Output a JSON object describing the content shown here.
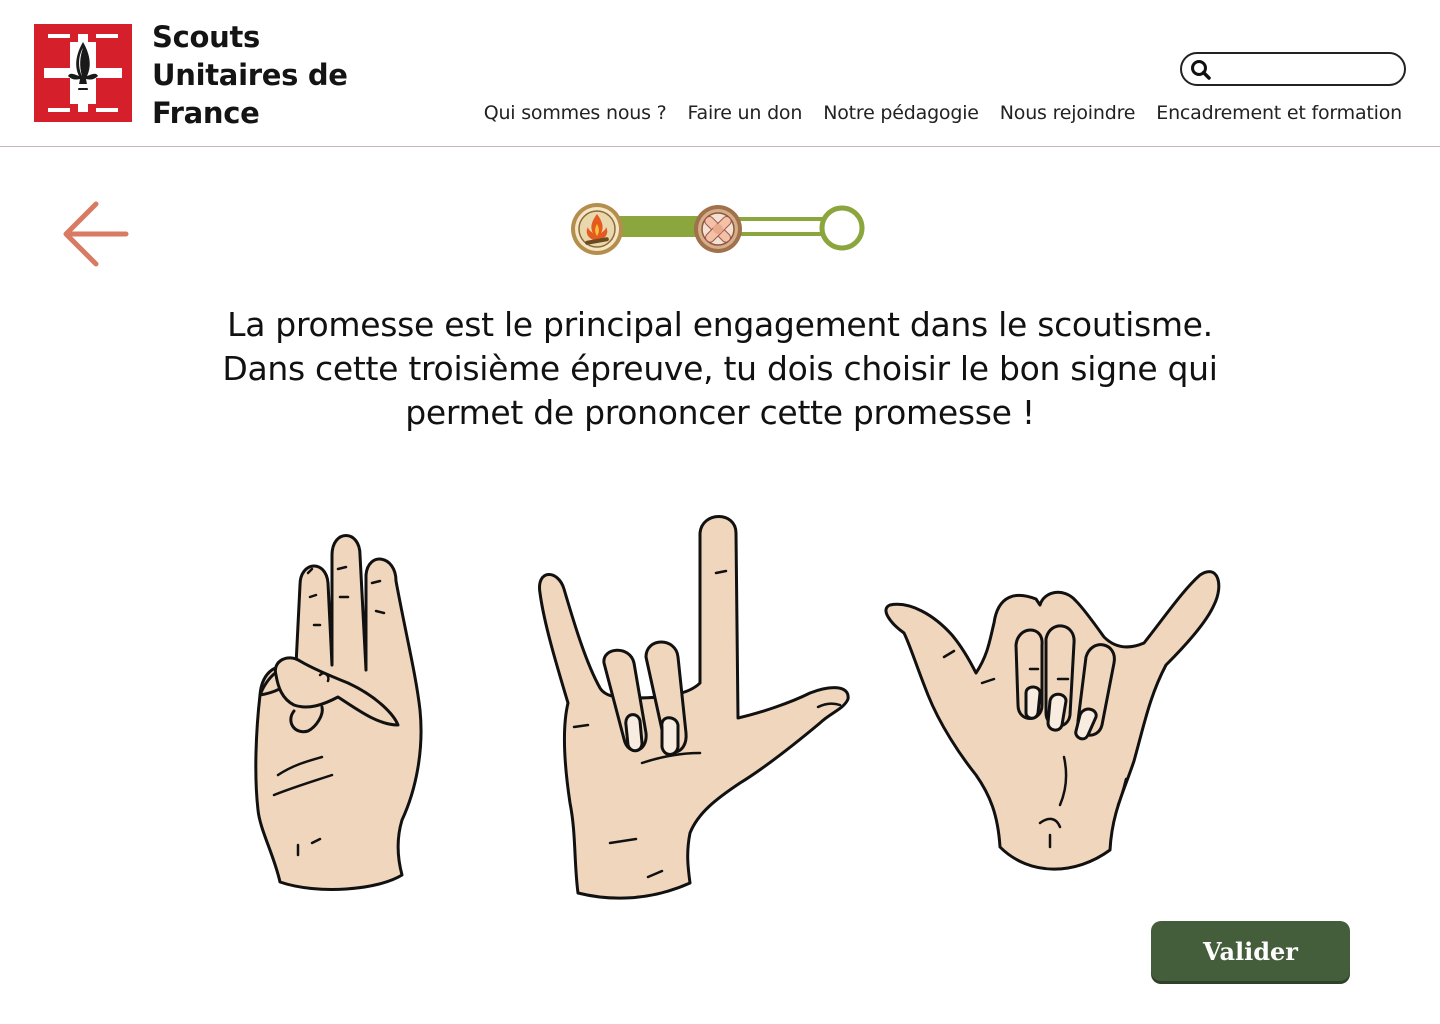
{
  "header": {
    "brand_lines": [
      "Scouts",
      "Unitaires de",
      "France"
    ],
    "logo": "scouts-unitaires-de-france-logo",
    "search": {
      "placeholder": "",
      "value": ""
    },
    "nav": [
      "Qui sommes nous ?",
      "Faire un don",
      "Notre pédagogie",
      "Nous rejoindre",
      "Encadrement et formation"
    ]
  },
  "progress": {
    "steps": [
      {
        "state": "completed",
        "icon": "campfire-badge-icon"
      },
      {
        "state": "completed",
        "icon": "bandage-badge-icon"
      },
      {
        "state": "current",
        "icon": "empty-circle-icon"
      }
    ],
    "completed_fraction": 0.67
  },
  "question": {
    "lines": [
      "La promesse est le principal engagement dans le scoutisme.",
      "Dans cette troisième épreuve, tu dois choisir le bon signe qui",
      "permet de prononcer cette promesse !"
    ]
  },
  "choices": [
    {
      "icon": "three-finger-salute-hand-icon"
    },
    {
      "icon": "index-and-thumb-hand-icon"
    },
    {
      "icon": "shaka-hand-icon"
    }
  ],
  "actions": {
    "validate_label": "Valider"
  },
  "colors": {
    "logo_red": "#d51f2b",
    "arrow": "#d97a63",
    "progress_green": "#8aa63d",
    "button": "#445e3b",
    "skin": "#f0d6bd"
  }
}
